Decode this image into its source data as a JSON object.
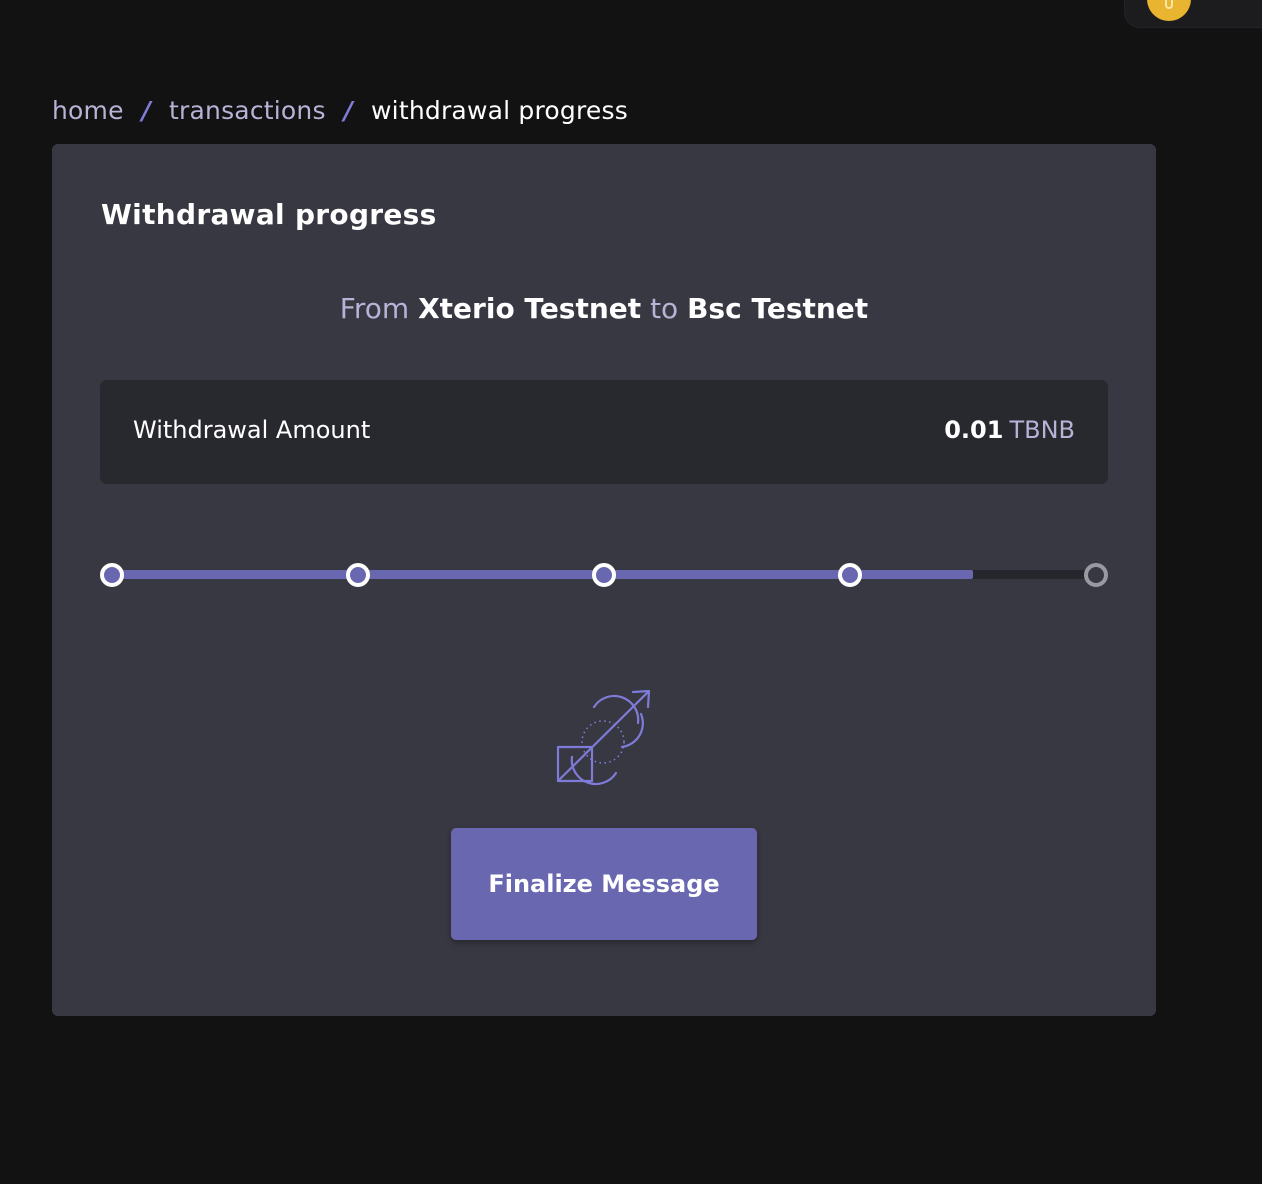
{
  "breadcrumb": {
    "items": [
      "home",
      "transactions"
    ],
    "separator": "/",
    "current": "withdrawal progress"
  },
  "card": {
    "title": "Withdrawal progress",
    "route": {
      "from_word": "From",
      "from_network": "Xterio Testnet",
      "to_word": "to",
      "to_network": "Bsc Testnet"
    },
    "amount": {
      "label": "Withdrawal Amount",
      "value": "0.01",
      "unit": "TBNB"
    },
    "progress": {
      "steps_total": 5,
      "steps_completed": 4,
      "fill_fraction": 0.875
    },
    "action_icon": "bridge-arrow-icon",
    "finalize_button": "Finalize Message"
  },
  "colors": {
    "background": "#121212",
    "card": "#383842",
    "panel": "#28282f",
    "accent": "#6a67b1",
    "muted_text": "#b6b3d6",
    "coin": "#e9b530"
  }
}
